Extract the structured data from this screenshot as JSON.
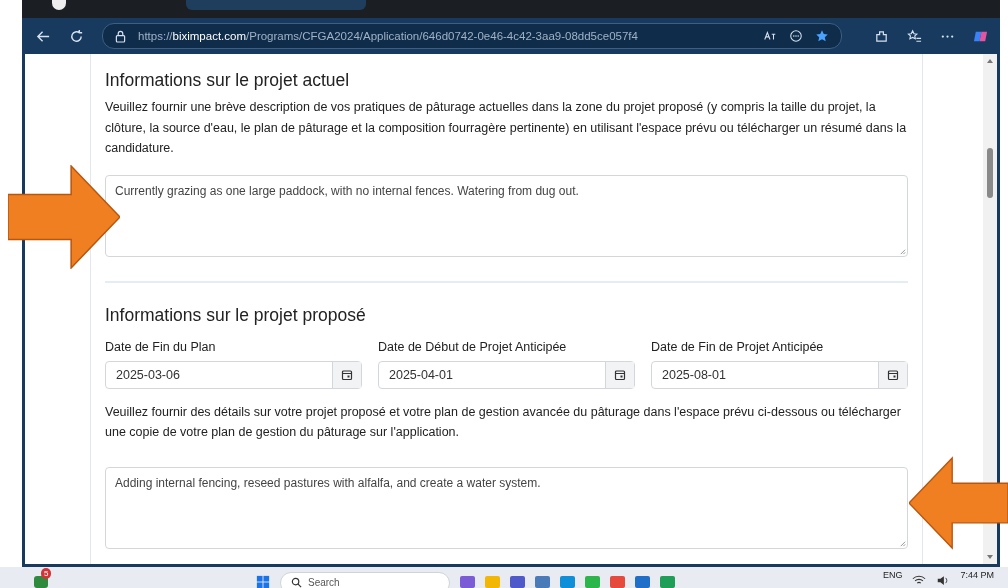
{
  "browser": {
    "url_scheme": "https://",
    "url_domain": "biximpact.com",
    "url_path": "/Programs/CFGA2024/Application/646d0742-0e46-4c42-3aa9-08dd5ce057f4"
  },
  "current_project": {
    "title": "Informations sur le projet actuel",
    "description": "Veuillez fournir une brève description de vos pratiques de pâturage actuelles dans la zone du projet proposé (y compris la taille du projet, la clôture, la source d'eau, le plan de pâturage et la composition fourragère pertinente) en utilisant l'espace prévu ou télécharger un résumé dans la candidature.",
    "answer": "Currently grazing as one large paddock, with no internal fences. Watering from dug out."
  },
  "proposed_project": {
    "title": "Informations sur le projet proposé",
    "dates": [
      {
        "label": "Date de Fin du Plan",
        "value": "2025-03-06"
      },
      {
        "label": "Date de Début de Projet Anticipée",
        "value": "2025-04-01"
      },
      {
        "label": "Date de Fin de Projet Anticipée",
        "value": "2025-08-01"
      }
    ],
    "description": "Veuillez fournir des détails sur votre projet proposé et votre plan de gestion avancée du pâturage dans l'espace prévu ci-dessous ou télécharger une copie de votre plan de gestion du pâturage sur l'application.",
    "answer": "Adding internal fencing, reseed pastures with alfalfa, and create a water system."
  },
  "annotations": [
    {
      "kind": "right_arrow"
    },
    {
      "kind": "left_arrow"
    }
  ],
  "taskbar": {
    "notification_count": "5",
    "search_placeholder": "Search",
    "language": "ENG",
    "time": "7:44 PM"
  }
}
